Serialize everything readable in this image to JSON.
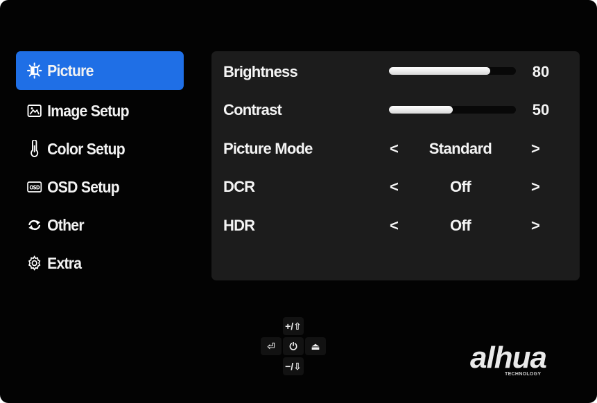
{
  "sidebar": {
    "items": [
      {
        "label": "Picture",
        "icon": "brightness-icon",
        "active": true
      },
      {
        "label": "Image Setup",
        "icon": "image-icon",
        "active": false
      },
      {
        "label": "Color Setup",
        "icon": "thermometer-icon",
        "active": false
      },
      {
        "label": "OSD Setup",
        "icon": "osd-icon",
        "active": false
      },
      {
        "label": "Other",
        "icon": "cycle-icon",
        "active": false
      },
      {
        "label": "Extra",
        "icon": "gear-icon",
        "active": false
      }
    ],
    "osd_icon_text": "OSD"
  },
  "settings": {
    "brightness": {
      "label": "Brightness",
      "value": "80",
      "level": 80
    },
    "contrast": {
      "label": "Contrast",
      "value": "50",
      "level": 50
    },
    "picture_mode": {
      "label": "Picture Mode",
      "value": "Standard"
    },
    "dcr": {
      "label": "DCR",
      "value": "Off"
    },
    "hdr": {
      "label": "HDR",
      "value": "Off"
    },
    "arrow_left": "<",
    "arrow_right": ">"
  },
  "controls": {
    "up": "+/⇧",
    "down": "−/⇩",
    "left": "⏎",
    "power": "⏻",
    "right": "⏏"
  },
  "logo": {
    "brand": "alhua",
    "tagline": "TECHNOLOGY"
  },
  "colors": {
    "accent": "#1f6fe6",
    "background": "#030303",
    "panel": "#1c1c1c"
  }
}
